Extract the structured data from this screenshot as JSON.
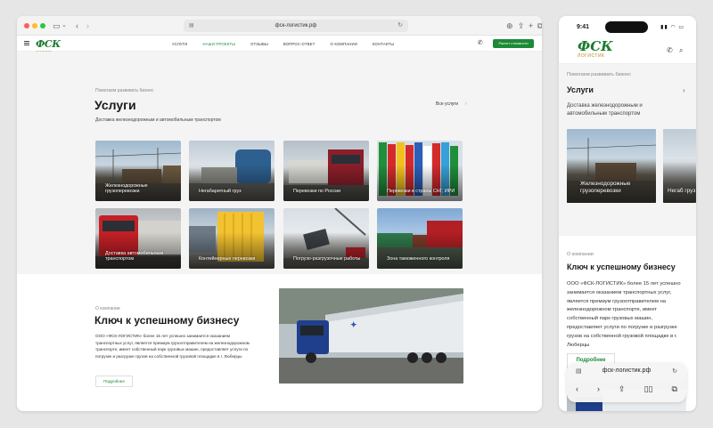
{
  "desktop": {
    "url": "фск-логистик.рф",
    "logo": {
      "mark": "ФСК",
      "sub": "ЛОГИСТИК"
    },
    "nav": [
      {
        "label": "Услуги",
        "active": false
      },
      {
        "label": "Наши проекты",
        "active": true
      },
      {
        "label": "Отзывы",
        "active": false
      },
      {
        "label": "Вопрос-ответ",
        "active": false
      },
      {
        "label": "О компании",
        "active": false
      },
      {
        "label": "Контакты",
        "active": false
      }
    ],
    "cta_label": "Расчет стоимости",
    "services": {
      "eyebrow": "Помогаем развивать бизнес",
      "title": "Услуги",
      "description": "Доставка железнодорожным и автомобильным транспортом",
      "all_link": "Все услуги",
      "cards": [
        "Железнодорожные грузоперевозки",
        "Негабаритный груз",
        "Перевозки по России",
        "Перевозки в страны СНГ, ИРИ",
        "Доставка автомобильным транспортом",
        "Контейнерные перевозки",
        "Погрузо-разгрузочные работы",
        "Зона таможенного контроля"
      ]
    },
    "about": {
      "eyebrow": "О компании",
      "title": "Ключ к успешному бизнесу",
      "text": "ООО «ФСК-ЛОГИСТИК» более 15 лет успешно занимается оказанием транспортных услуг, является премиум грузоотправителем на железнодорожном транспорте, имеет собственный парк грузовых машин, предоставляет услуги по погрузке и разгрузке грузов на собственной грузовой площадке в г. Люберцы",
      "button": "Подробнее"
    }
  },
  "mobile": {
    "time": "9:41",
    "logo": {
      "mark": "ФСК",
      "sub": "ЛОГИСТИК"
    },
    "services": {
      "eyebrow": "Помогаем развивать бизнес",
      "title": "Услуги",
      "description": "Доставка железнодорожным и автомобильным транспортом",
      "cards": [
        "Железнодорожные грузоперевозки",
        "Негаб груз"
      ]
    },
    "about": {
      "eyebrow": "О компании",
      "title": "Ключ к успешному бизнесу",
      "text": "ООО «ФСК-ЛОГИСТИК» более 15 лет успешно занимается оказанием транспортных услуг, является премиум грузоотправителем на железнодорожном транспорте, имеет собственный парк грузовых машин, предоставляет услуги по погрузке и разгрузке грузов на собственной грузовой площадке в г. Люберцы",
      "button": "Подробнее"
    },
    "safari_url": "фск-логистик.рф",
    "safari_lang": "AA"
  },
  "colors": {
    "brand_green": "#1c8a36",
    "logo_gold": "#b38a1e",
    "section_bg": "#f4f4f4"
  }
}
